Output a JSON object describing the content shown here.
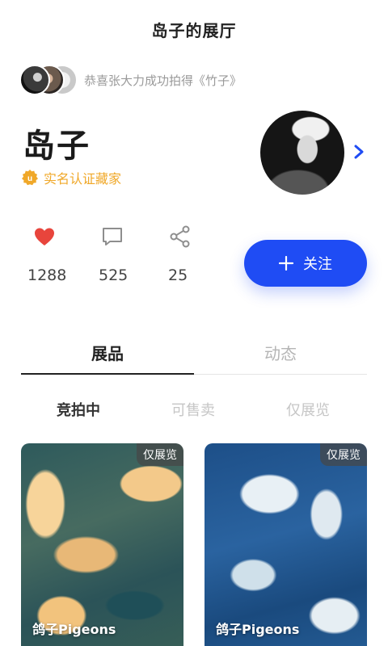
{
  "header": {
    "title": "岛子的展厅"
  },
  "announcement": {
    "text": "恭喜张大力成功拍得《竹子》"
  },
  "profile": {
    "name": "岛子",
    "verified_label": "实名认证藏家"
  },
  "stats": [
    {
      "icon": "heart-icon",
      "count": "1288"
    },
    {
      "icon": "comment-icon",
      "count": "525"
    },
    {
      "icon": "share-icon",
      "count": "25"
    }
  ],
  "follow": {
    "label": "关注"
  },
  "tabs": [
    {
      "label": "展品",
      "active": true
    },
    {
      "label": "动态",
      "active": false
    }
  ],
  "subtabs": [
    {
      "label": "竞拍中",
      "active": true
    },
    {
      "label": "可售卖",
      "active": false
    },
    {
      "label": "仅展览",
      "active": false
    }
  ],
  "cards": [
    {
      "badge": "仅展览",
      "title": "鸽子Pigeons"
    },
    {
      "badge": "仅展览",
      "title": "鸽子Pigeons"
    }
  ],
  "colors": {
    "accent": "#1f4cf4",
    "heart": "#e8453c",
    "verified": "#f0a829"
  }
}
